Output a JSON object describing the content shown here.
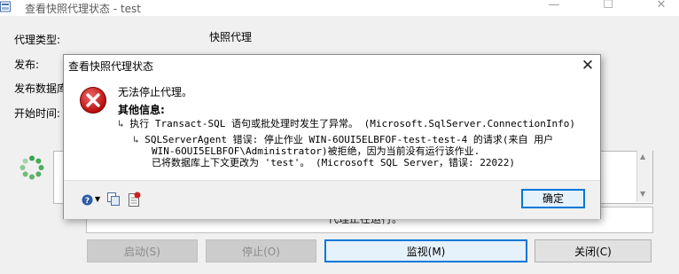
{
  "window": {
    "title": "查看快照代理状态 - test",
    "minimize_glyph": "—",
    "maximize_glyph": "☐",
    "close_glyph": "✕"
  },
  "background": {
    "labels": {
      "agent_type": "代理类型:",
      "publication": "发布:",
      "publication_db": "发布数据库",
      "start_time": "开始时间:"
    },
    "agent_type_value": "快照代理",
    "status_text": "代理正在运行。",
    "buttons": {
      "start": "启动(S)",
      "stop": "停止(O)",
      "monitor": "监视(M)",
      "close": "关闭(C)"
    }
  },
  "dialog": {
    "title": "查看快照代理状态",
    "close_glyph": "✕",
    "message": "无法停止代理。",
    "additional_info_label": "其他信息:",
    "arrow": "↳",
    "line1": "执行 Transact-SQL 语句或批处理时发生了异常。 (Microsoft.SqlServer.ConnectionInfo)",
    "detail": {
      "row1": "SQLServerAgent 错误: 停止作业 WIN-6OUI5ELBFOF-test-test-4 的请求(来自 用户",
      "row2": "WIN-6OUI5ELBFOF\\Administrator)被拒绝，因为当前没有运行该作业.",
      "row3": "已将数据库上下文更改为 'test'。 (Microsoft SQL Server，错误: 22022)"
    },
    "ok_label": "确定",
    "icons": {
      "error": "error-icon",
      "help": "help-icon",
      "copy": "copy-icon",
      "details": "details-icon"
    }
  }
}
